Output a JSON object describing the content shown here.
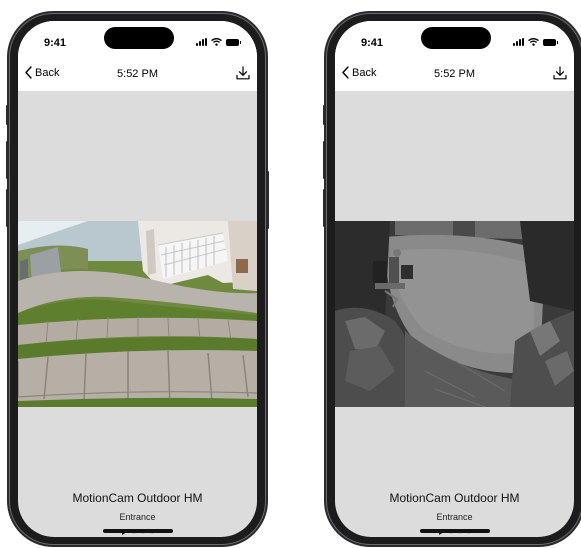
{
  "phones": [
    {
      "status_time": "9:41",
      "nav": {
        "back_label": "Back",
        "title": "5:52 PM"
      },
      "video": {
        "mode": "day-color"
      },
      "camera": {
        "name": "MotionCam Outdoor HM",
        "location": "Entrance"
      },
      "pager": {
        "count": 4,
        "active": 0
      }
    },
    {
      "status_time": "9:41",
      "nav": {
        "back_label": "Back",
        "title": "5:52 PM"
      },
      "video": {
        "mode": "night-infrared"
      },
      "camera": {
        "name": "MotionCam Outdoor HM",
        "location": "Entrance"
      },
      "pager": {
        "count": 4,
        "active": 0
      }
    }
  ],
  "icons": {
    "back": "chevron-left-icon",
    "download": "download-icon",
    "signal": "signal-icon",
    "wifi": "wifi-icon",
    "battery": "battery-icon"
  },
  "colors": {
    "screen_bg": "#dcdcdc",
    "header_bg": "#ffffff",
    "phone_frame": "#1c1c1e"
  }
}
